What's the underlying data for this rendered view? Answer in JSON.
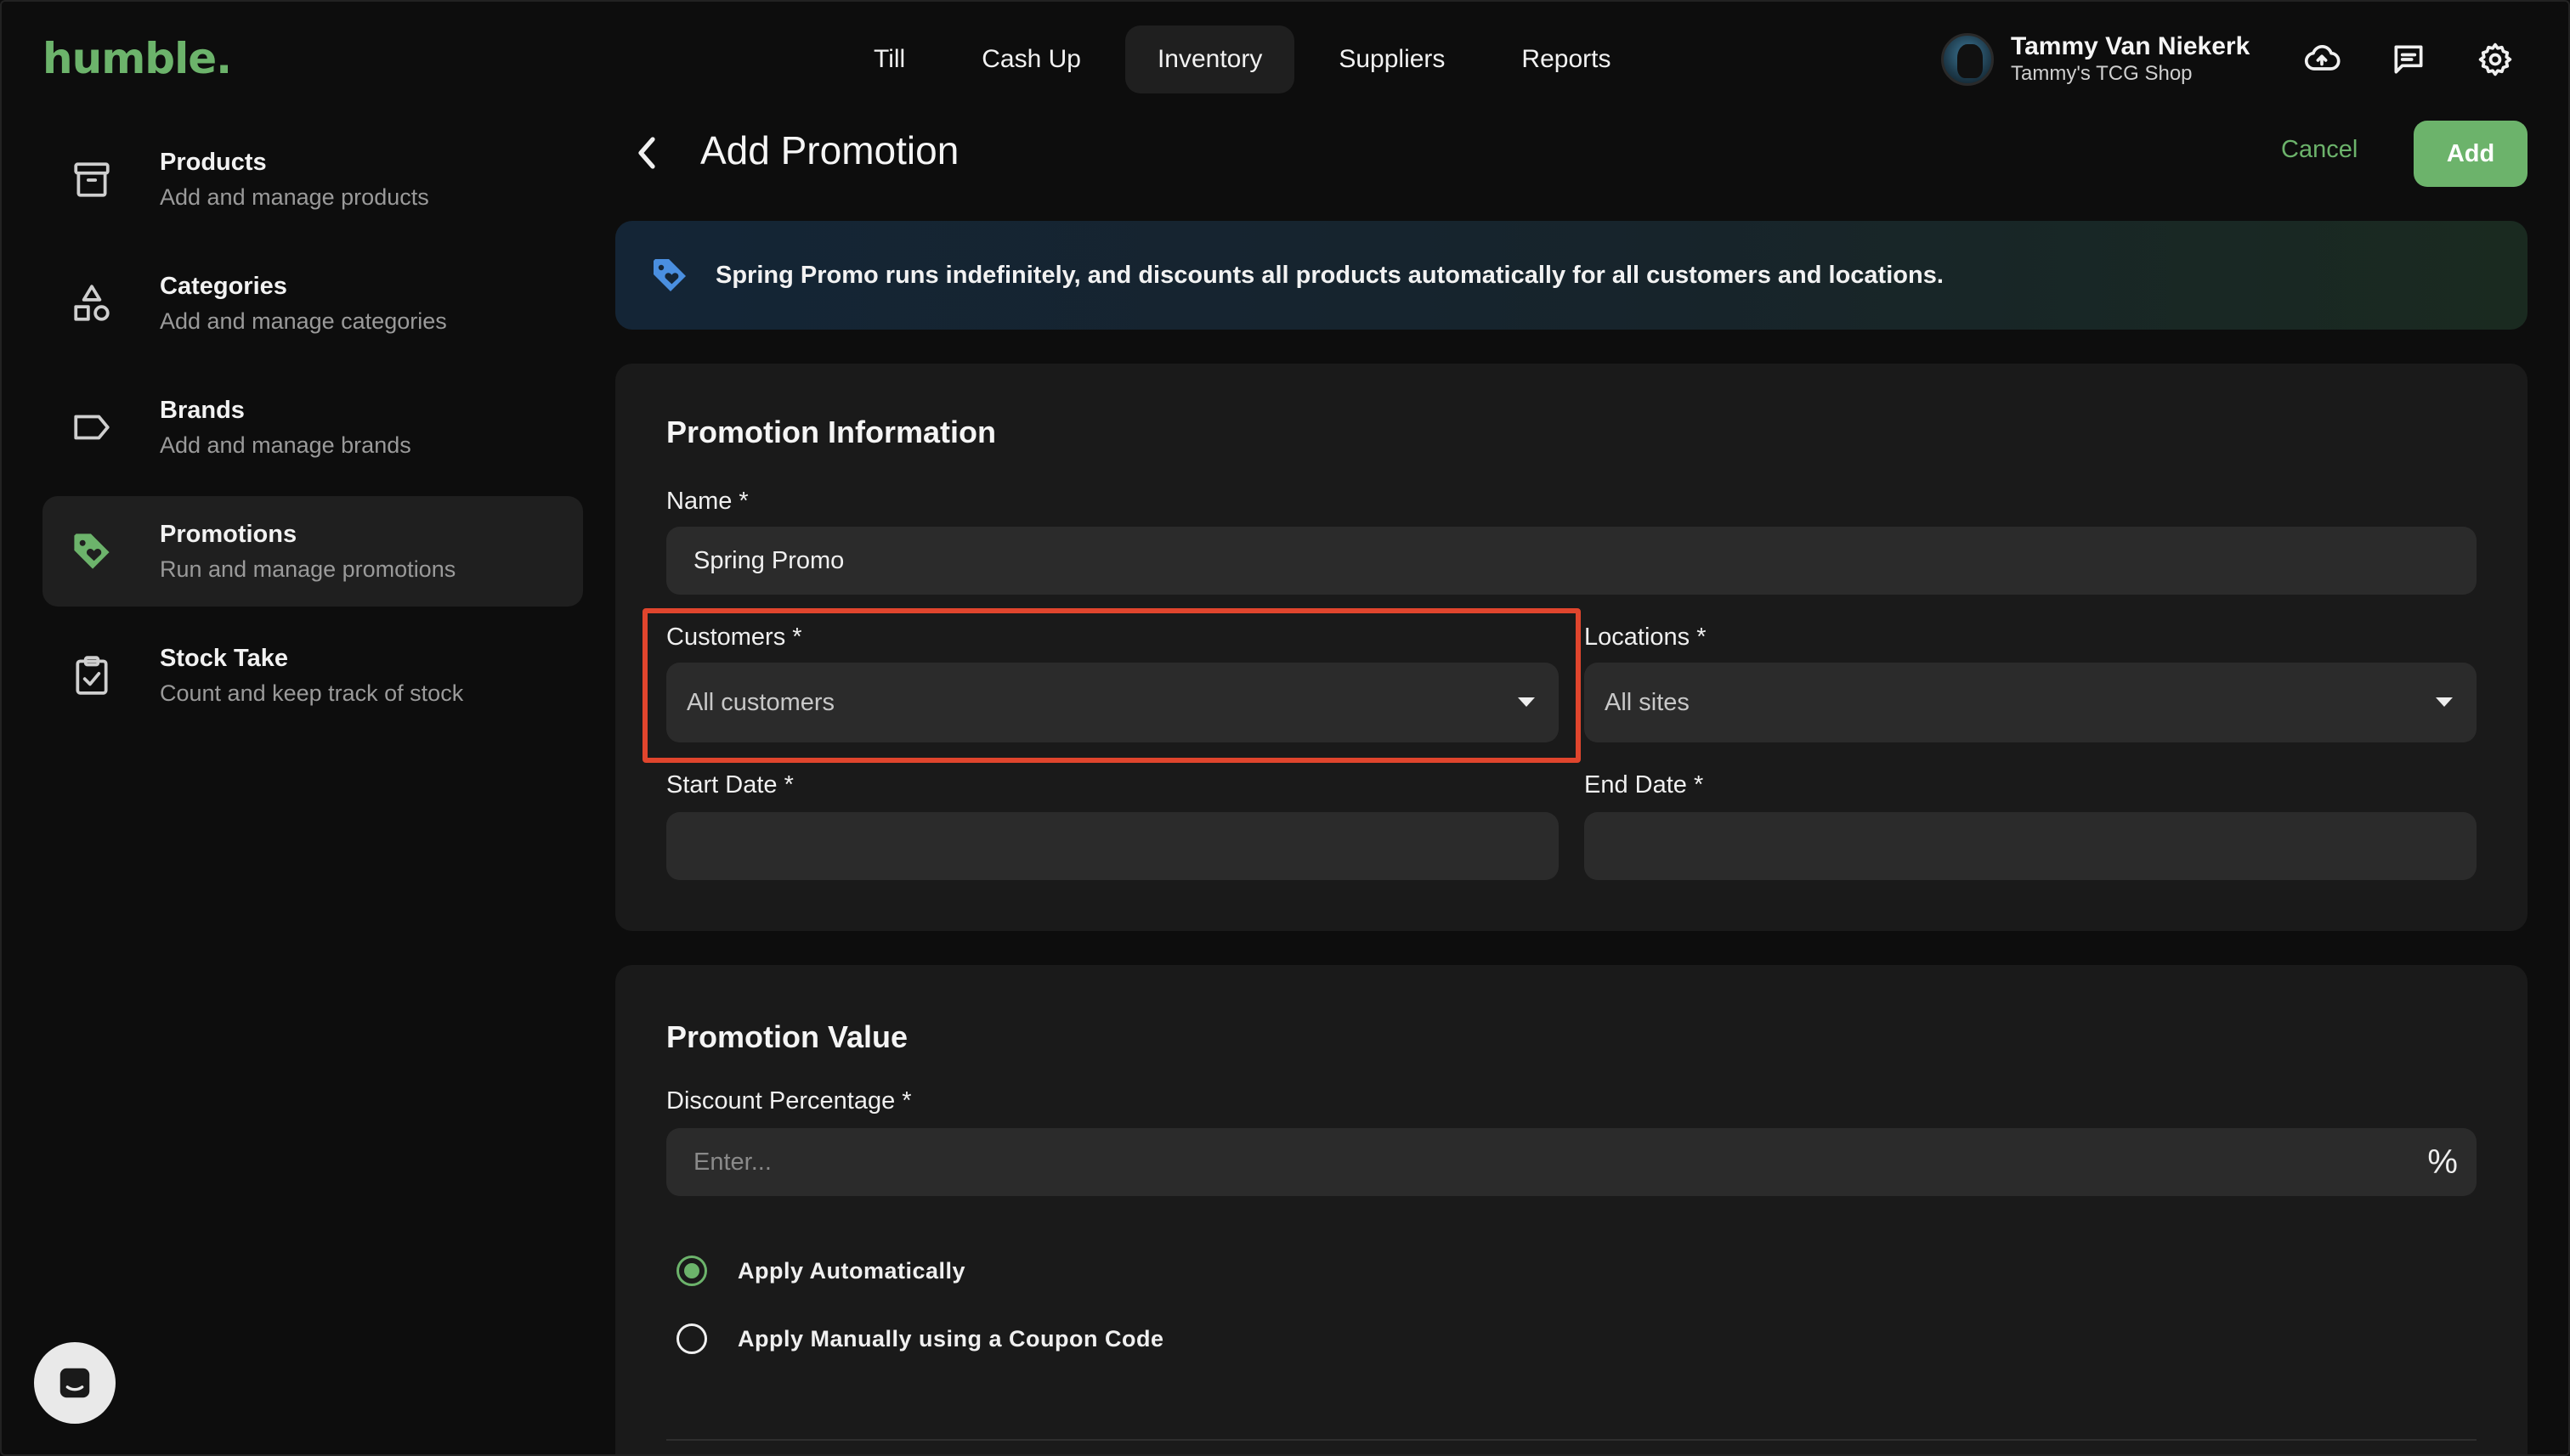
{
  "brand": {
    "logo": "humble."
  },
  "topnav": {
    "items": [
      {
        "label": "Till"
      },
      {
        "label": "Cash Up"
      },
      {
        "label": "Inventory",
        "active": true
      },
      {
        "label": "Suppliers"
      },
      {
        "label": "Reports"
      }
    ]
  },
  "user": {
    "name": "Tammy Van Niekerk",
    "shop": "Tammy's TCG Shop"
  },
  "top_icons": [
    "cloud-upload-icon",
    "message-icon",
    "settings-gear-icon"
  ],
  "sidebar": {
    "items": [
      {
        "title": "Products",
        "subtitle": "Add and manage products",
        "icon": "archive-box-icon"
      },
      {
        "title": "Categories",
        "subtitle": "Add and manage categories",
        "icon": "shapes-icon"
      },
      {
        "title": "Brands",
        "subtitle": "Add and manage brands",
        "icon": "label-tag-icon"
      },
      {
        "title": "Promotions",
        "subtitle": "Run and manage promotions",
        "icon": "promo-tag-icon",
        "active": true
      },
      {
        "title": "Stock Take",
        "subtitle": "Count and keep track of stock",
        "icon": "clipboard-check-icon"
      }
    ]
  },
  "header": {
    "title": "Add Promotion",
    "cancel_label": "Cancel",
    "add_label": "Add"
  },
  "banner": {
    "text": "Spring Promo runs indefinitely, and discounts all products automatically for all customers and locations."
  },
  "promotion_info": {
    "title": "Promotion Information",
    "name_label": "Name *",
    "name_value": "Spring Promo",
    "customers_label": "Customers *",
    "customers_value": "All customers",
    "locations_label": "Locations *",
    "locations_value": "All sites",
    "start_date_label": "Start Date *",
    "start_date_value": "",
    "end_date_label": "End Date *",
    "end_date_value": ""
  },
  "promotion_value": {
    "title": "Promotion Value",
    "discount_label": "Discount Percentage *",
    "discount_placeholder": "Enter...",
    "discount_suffix": "%",
    "options": [
      {
        "label": "Apply Automatically",
        "selected": true
      },
      {
        "label": "Apply Manually using a Coupon Code",
        "selected": false
      }
    ]
  },
  "colors": {
    "accent": "#6cb36b",
    "background": "#0d0d0d",
    "card": "#1a1a1a",
    "input": "#2b2b2b",
    "highlight": "#e0452d"
  }
}
